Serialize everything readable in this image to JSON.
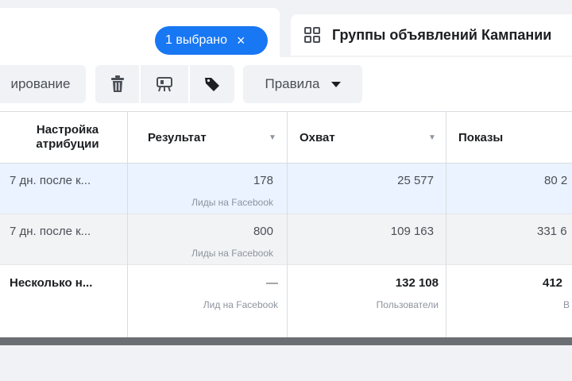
{
  "tabs": {
    "selection_pill": {
      "label": "1 выбрано",
      "close": "×"
    },
    "ad_groups_tab": {
      "label": "Группы объявлений Кампании"
    }
  },
  "toolbar": {
    "dup_label": "ирование",
    "rules_label": "Правила"
  },
  "table": {
    "headers": {
      "attribution": [
        "Настройка",
        "атрибуции"
      ],
      "result": "Результат",
      "reach": "Охват",
      "impressions": "Показы"
    },
    "rows": [
      {
        "attribution": "7 дн. после к...",
        "result": "178",
        "result_sub": "Лиды на Facebook",
        "reach": "25 577",
        "reach_sub": "",
        "impressions": "80 2",
        "impressions_sub": ""
      },
      {
        "attribution": "7 дн. после к...",
        "result": "800",
        "result_sub": "Лиды на Facebook",
        "reach": "109 163",
        "reach_sub": "",
        "impressions": "331 6",
        "impressions_sub": ""
      },
      {
        "attribution": "Несколько н...",
        "result": "—",
        "result_sub": "Лид на Facebook",
        "reach": "132 108",
        "reach_sub": "Пользователи",
        "impressions": "412",
        "impressions_sub": "В"
      }
    ]
  },
  "colors": {
    "accent": "#1877f2",
    "selected_row": "#eaf3ff",
    "hover_row": "#f2f3f5"
  }
}
